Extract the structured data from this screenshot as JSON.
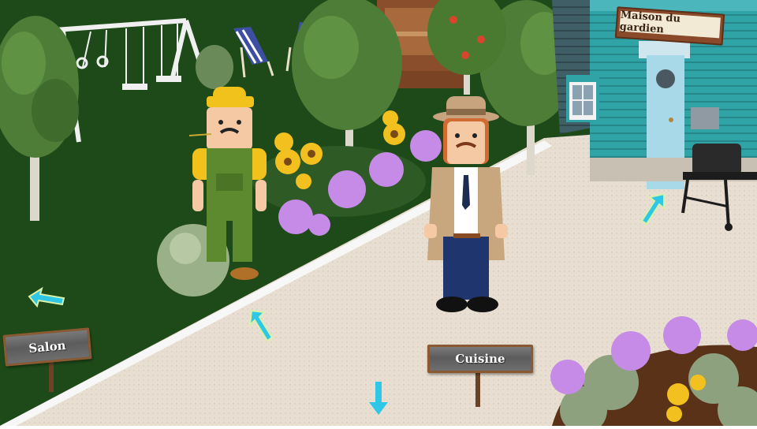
{
  "signs": {
    "salon": "Salon",
    "cuisine": "Cuisine",
    "house": "Maison du gardien"
  },
  "navigation": {
    "arrows": [
      {
        "id": "left",
        "target": "Salon",
        "direction": "left"
      },
      {
        "id": "up-path",
        "target": "path",
        "direction": "up-left"
      },
      {
        "id": "down",
        "target": "Cuisine",
        "direction": "down"
      },
      {
        "id": "house",
        "target": "Maison du gardien",
        "direction": "up-right"
      }
    ],
    "arrow_color": "#2fc7e8"
  },
  "characters": [
    {
      "name": "gardener",
      "icon": "gardener-character"
    },
    {
      "name": "detective",
      "icon": "detective-character"
    }
  ],
  "colors": {
    "lawn": "#1f4a1a",
    "path": "#e6ddd0",
    "house": "#2fa7a7",
    "door": "#a8d9e8"
  }
}
